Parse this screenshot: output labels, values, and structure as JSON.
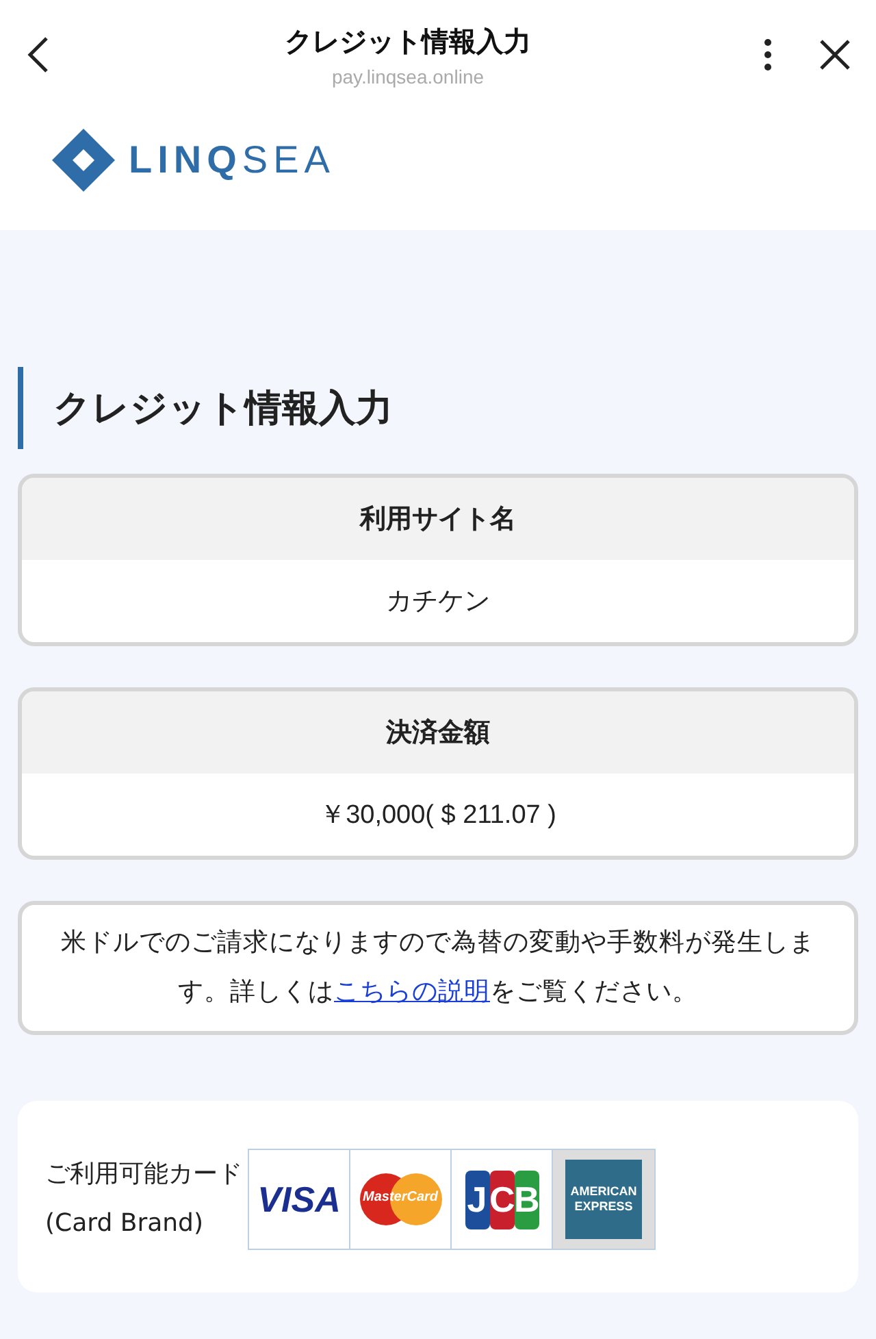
{
  "header": {
    "title": "クレジット情報入力",
    "url": "pay.linqsea.online"
  },
  "brand": {
    "name_bold": "LINQ",
    "name_light": "SEA"
  },
  "section_title": "クレジット情報入力",
  "fields": [
    {
      "label": "利用サイト名",
      "value": "カチケン"
    },
    {
      "label": "決済金額",
      "value": "￥30,000( $ 211.07 )"
    }
  ],
  "note": {
    "before": "米ドルでのご請求になりますので為替の変動や手数料が発生します。詳しくは",
    "link": "こちらの説明",
    "after": "をご覧ください。"
  },
  "cards_section": {
    "label_lines": [
      "ご利用可能カード",
      "(Card Brand)"
    ],
    "cards": [
      {
        "kind": "visa",
        "text": "VISA"
      },
      {
        "kind": "mastercard",
        "text": "MasterCard"
      },
      {
        "kind": "jcb",
        "text": "JCB"
      },
      {
        "kind": "amex",
        "text": "AMERICAN EXPRESS"
      }
    ]
  }
}
